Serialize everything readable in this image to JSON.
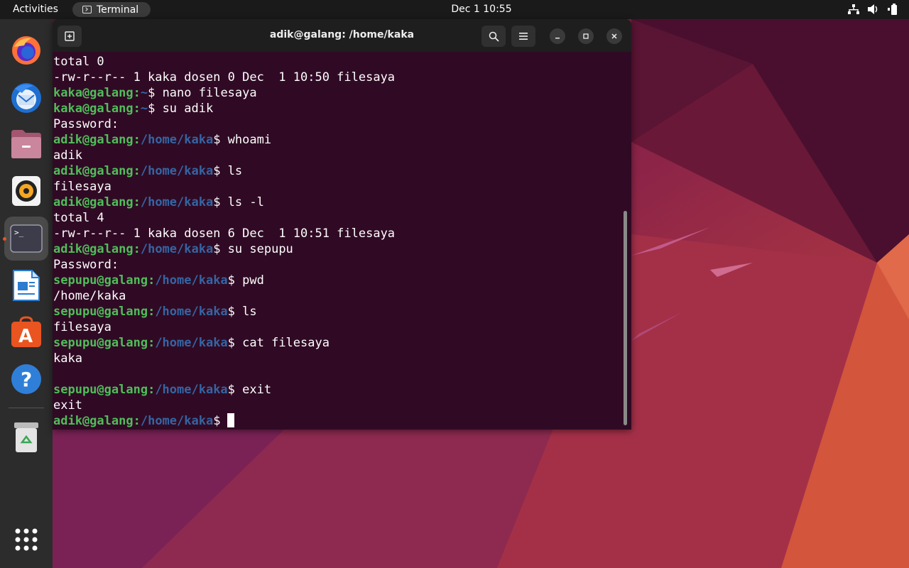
{
  "topbar": {
    "activities": "Activities",
    "app_name": "Terminal",
    "clock": "Dec 1  10:55"
  },
  "dock": {
    "apps": [
      "firefox-icon",
      "thunderbird-icon",
      "files-icon",
      "rhythmbox-icon",
      "terminal-icon",
      "writer-icon",
      "app-center-icon",
      "help-icon",
      "trash-icon",
      "show-apps-icon"
    ]
  },
  "window": {
    "title": "adik@galang: /home/kaka"
  },
  "terminal": {
    "lines": [
      {
        "out": "total 0"
      },
      {
        "out": "-rw-r--r-- 1 kaka dosen 0 Dec  1 10:50 filesaya"
      },
      {
        "user": "kaka@galang",
        "path": "~",
        "cmd": "$ nano filesaya"
      },
      {
        "user": "kaka@galang",
        "path": "~",
        "cmd": "$ su adik"
      },
      {
        "out": "Password:"
      },
      {
        "user": "adik@galang",
        "path": "/home/kaka",
        "cmd": "$ whoami"
      },
      {
        "out": "adik"
      },
      {
        "user": "adik@galang",
        "path": "/home/kaka",
        "cmd": "$ ls"
      },
      {
        "out": "filesaya"
      },
      {
        "user": "adik@galang",
        "path": "/home/kaka",
        "cmd": "$ ls -l"
      },
      {
        "out": "total 4"
      },
      {
        "out": "-rw-r--r-- 1 kaka dosen 6 Dec  1 10:51 filesaya"
      },
      {
        "user": "adik@galang",
        "path": "/home/kaka",
        "cmd": "$ su sepupu"
      },
      {
        "out": "Password:"
      },
      {
        "user": "sepupu@galang",
        "path": "/home/kaka",
        "cmd": "$ pwd"
      },
      {
        "out": "/home/kaka"
      },
      {
        "user": "sepupu@galang",
        "path": "/home/kaka",
        "cmd": "$ ls"
      },
      {
        "out": "filesaya"
      },
      {
        "user": "sepupu@galang",
        "path": "/home/kaka",
        "cmd": "$ cat filesaya"
      },
      {
        "out": "kaka"
      },
      {
        "out": ""
      },
      {
        "user": "sepupu@galang",
        "path": "/home/kaka",
        "cmd": "$ exit"
      },
      {
        "out": "exit"
      },
      {
        "user": "adik@galang",
        "path": "/home/kaka",
        "cmd": "$",
        "cursor": true
      }
    ]
  },
  "colors": {
    "terminal_bg": "#300a24",
    "prompt_user": "#4fbe5a",
    "prompt_path": "#3465a4",
    "accent": "#e95420"
  }
}
